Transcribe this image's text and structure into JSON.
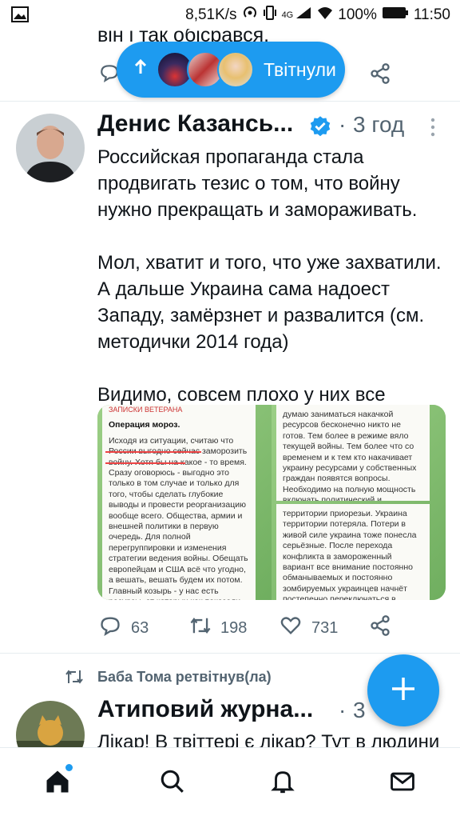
{
  "status_bar": {
    "network_speed": "8,51K/s",
    "network_type": "4G",
    "battery": "100%",
    "time": "11:50"
  },
  "previous_tweet": {
    "text_fragment": "він і так обісрався."
  },
  "new_tweets_pill": {
    "label": "Твітнули"
  },
  "tweet": {
    "author_name": "Денис Казансь...",
    "verified": true,
    "separator": "·",
    "time": "3 год",
    "paragraphs": [
      "Российская пропаганда стала продвигать тезис о том, что войну нужно прекращать и замораживать.",
      "Мол, хватит и того, что уже захватили. А дальше Украина сама надоест Западу, замёрзнет и развалится (см. методички 2014 года)",
      "Видимо, совсем плохо у них все"
    ],
    "media": {
      "left_header": "ЗАПИСКИ ВЕТЕРАНА",
      "left_title": "Операция мороз.",
      "left_text": "Исходя из ситуации, считаю что России выгодно сейчас заморозить войну. Хотя бы на какое - то время. Сразу оговорюсь - выгодно это только в том случае и только для того, чтобы сделать глубокие выводы и провести реорганизацию вообще всего. Общества, армии и внешней политики в первую очередь. Для полной перегруппировки и изменения стратегии ведения войны. Обещать европейцам и США всё что угодно, а вешать, вешать будем их потом. Главный козырь - у нас есть ресурсы, от которых как показали",
      "right_text_top": "думаю заниматься накачкой ресурсов бесконечно никто не готов. Тем более в режиме вяло текущей войны. Тем более что со временем и к тем кто накачивает украину ресурсами у собственных граждан появятся вопросы. Необходимо на полную мощность включать политический и сырьевой, ресурсный шантаж. По",
      "right_text_bottom": "территории приорезьи. Украина территории потеряла. Потери в живой силе украина тоже понесла серьёзные. После перехода конфликта в замороженный вариант все внимание постоянно обманываемых и постоянно зомбируемых украинцев начнёт постепенно переключаться в социальную плоскость. Начнутся"
    },
    "replies": "63",
    "retweets": "198",
    "likes": "731"
  },
  "next_tweet": {
    "retweet_note": "Баба Тома ретвітнув(ла)",
    "author_name": "Атиповий журна...",
    "separator": "·",
    "time_fragment": "3",
    "text_fragment": "Лікар! В твіттері є лікар? Тут в людини"
  },
  "colors": {
    "accent": "#1d9bf0",
    "text_primary": "#0f1419",
    "text_secondary": "#536471"
  },
  "icons": {
    "reply": "reply-icon",
    "retweet": "retweet-icon",
    "like": "heart-icon",
    "share": "share-icon",
    "compose": "plus-icon",
    "home": "home-icon",
    "search": "search-icon",
    "notifications": "bell-icon",
    "messages": "mail-icon"
  }
}
